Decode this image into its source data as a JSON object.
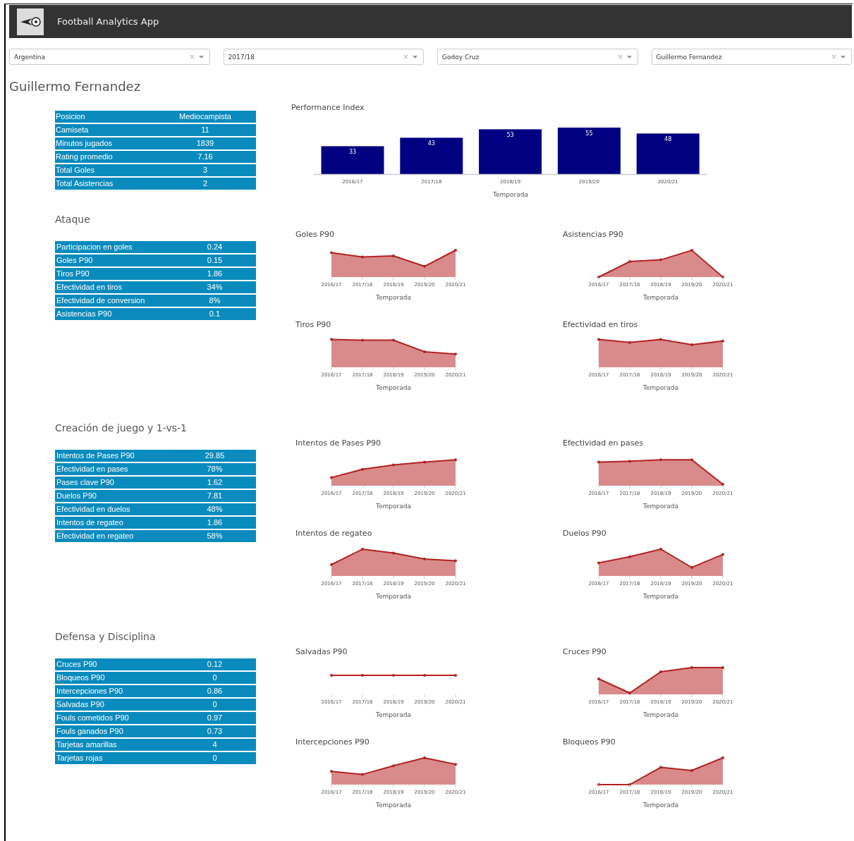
{
  "header": {
    "title": "Football Analytics App"
  },
  "filters": [
    {
      "value": "Argentina"
    },
    {
      "value": "2017/18"
    },
    {
      "value": "Godoy Cruz"
    },
    {
      "value": "Guillermo Fernandez"
    }
  ],
  "player_name": "Guillermo Fernandez",
  "summary": {
    "rows": [
      {
        "label": "Posicion",
        "value": "Mediocampista"
      },
      {
        "label": "Camiseta",
        "value": "11"
      },
      {
        "label": "Minutos jugados",
        "value": "1839"
      },
      {
        "label": "Rating promedio",
        "value": "7.16"
      },
      {
        "label": "Total Goles",
        "value": "3"
      },
      {
        "label": "Total Asistencias",
        "value": "2"
      }
    ],
    "chart_data": {
      "type": "bar",
      "title": "Performance Index",
      "xlabel": "Temporada",
      "categories": [
        "2016/17",
        "2017/18",
        "2018/19",
        "2019/20",
        "2020/21"
      ],
      "values": [
        33,
        43,
        53,
        55,
        48
      ],
      "data_labels": true
    }
  },
  "sections": [
    {
      "heading": "Ataque",
      "rows": [
        {
          "label": "Participacion en goles",
          "value": "0.24"
        },
        {
          "label": "Goles P90",
          "value": "0.15"
        },
        {
          "label": "Tiros P90",
          "value": "1.86"
        },
        {
          "label": "Efectividad en tiros",
          "value": "34%"
        },
        {
          "label": "Efectividad de conversion",
          "value": "8%"
        },
        {
          "label": "Asistencias P90",
          "value": "0.1"
        }
      ],
      "charts": [
        {
          "title": "Goles P90",
          "x_labels": [
            "2016/17",
            "2017/18",
            "2018/19",
            "2019/20",
            "2020/21"
          ],
          "xlabel": "Temporada"
        },
        {
          "title": "Asistencias P90",
          "x_labels": [
            "2016/17",
            "2017/18",
            "2018/19",
            "2019/20",
            "2020/21"
          ],
          "xlabel": "Temporada"
        },
        {
          "title": "Tiros P90",
          "x_labels": [
            "2016/17",
            "2017/18",
            "2018/19",
            "2019/20",
            "2020/21"
          ],
          "xlabel": "Temporada"
        },
        {
          "title": "Efectividad en tiros",
          "x_labels": [
            "2016/17",
            "2017/18",
            "2018/19",
            "2019/20",
            "2020/21"
          ],
          "xlabel": "Temporada"
        }
      ]
    },
    {
      "heading": "Creación de juego y 1-vs-1",
      "rows": [
        {
          "label": "Intentos de Pases P90",
          "value": "29.85"
        },
        {
          "label": "Efectividad en pases",
          "value": "78%"
        },
        {
          "label": "Pases clave P90",
          "value": "1.62"
        },
        {
          "label": "Duelos P90",
          "value": "7.81"
        },
        {
          "label": "Efectividad en duelos",
          "value": "48%"
        },
        {
          "label": "Intentos de regateo",
          "value": "1.86"
        },
        {
          "label": "Efectividad en regateo",
          "value": "58%"
        }
      ],
      "charts": [
        {
          "title": "Intentos de Pases P90",
          "x_labels": [
            "2016/17",
            "2017/18",
            "2018/19",
            "2019/20",
            "2020/21"
          ],
          "xlabel": "Temporada"
        },
        {
          "title": "Efectividad en pases",
          "x_labels": [
            "2016/17",
            "2017/18",
            "2018/19",
            "2019/20",
            "2020/21"
          ],
          "xlabel": "Temporada"
        },
        {
          "title": "Intentos de regateo",
          "x_labels": [
            "2016/17",
            "2017/18",
            "2018/19",
            "2019/20",
            "2020/21"
          ],
          "xlabel": "Temporada"
        },
        {
          "title": "Duelos P90",
          "x_labels": [
            "2016/17",
            "2017/18",
            "2018/19",
            "2019/20",
            "2020/21"
          ],
          "xlabel": "Temporada"
        }
      ]
    },
    {
      "heading": "Defensa y Disciplina",
      "rows": [
        {
          "label": "Cruces P90",
          "value": "0.12"
        },
        {
          "label": "Bloqueos P90",
          "value": "0"
        },
        {
          "label": "Intercepciones P90",
          "value": "0.86"
        },
        {
          "label": "Salvadas P90",
          "value": "0"
        },
        {
          "label": "Fouls cometidos P90",
          "value": "0.97"
        },
        {
          "label": "Fouls ganados P90",
          "value": "0.73"
        },
        {
          "label": "Tarjetas amarillas",
          "value": "4"
        },
        {
          "label": "Tarjetas rojas",
          "value": "0"
        }
      ],
      "charts": [
        {
          "title": "Salvadas P90",
          "x_labels": [
            "2016/17",
            "2017/18",
            "2018/19",
            "2019/20",
            "2020/21"
          ],
          "xlabel": "Temporada"
        },
        {
          "title": "Cruces P90",
          "x_labels": [
            "2016/17",
            "2017/18",
            "2018/19",
            "2019/20",
            "2020/21"
          ],
          "xlabel": "Temporada"
        },
        {
          "title": "Intercepciones P90",
          "x_labels": [
            "2016/17",
            "2017/18",
            "2018/19",
            "2019/20",
            "2020/21"
          ],
          "xlabel": "Temporada"
        },
        {
          "title": "Bloqueos P90",
          "x_labels": [
            "2016/17",
            "2017/18",
            "2018/19",
            "2019/20",
            "2020/21"
          ],
          "xlabel": "Temporada"
        }
      ]
    }
  ]
}
